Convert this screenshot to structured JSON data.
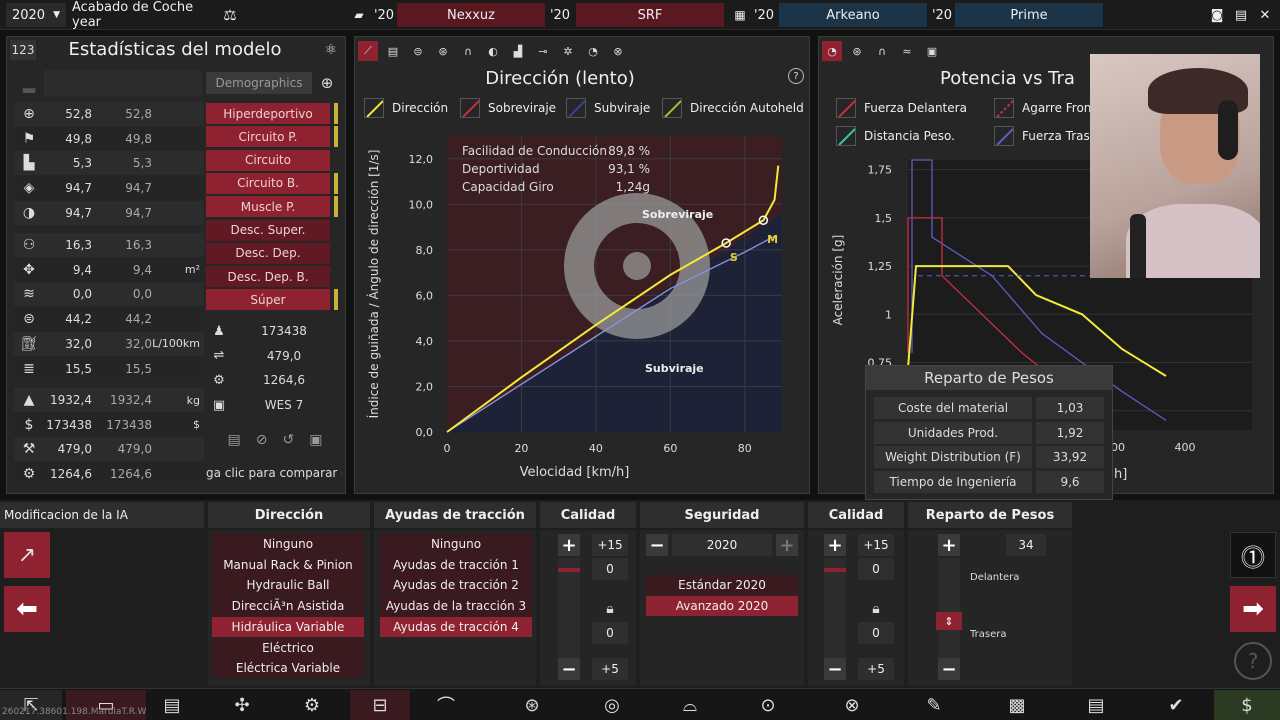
{
  "topbar": {
    "year": "2020",
    "finish": "Acabado de Coche year",
    "competitors": [
      {
        "year": "'20",
        "name": "Nexxuz"
      },
      {
        "year": "'20",
        "name": "SRF"
      },
      {
        "year": "'20",
        "name": "Arkeano"
      },
      {
        "year": "'20",
        "name": "Prime"
      }
    ]
  },
  "left_panel": {
    "badge": "123",
    "title": "Estadísticas del modelo",
    "demographics_label": "Demographics",
    "stats_a": [
      {
        "icon": "steering-icon",
        "v1": "52,8",
        "v2": "52,8",
        "unit": ""
      },
      {
        "icon": "checkered-flag-icon",
        "v1": "49,8",
        "v2": "49,8",
        "unit": ""
      },
      {
        "icon": "seat-icon",
        "v1": "5,3",
        "v2": "5,3",
        "unit": ""
      },
      {
        "icon": "gem-icon",
        "v1": "94,7",
        "v2": "94,7",
        "unit": ""
      },
      {
        "icon": "shield-icon",
        "v1": "94,7",
        "v2": "94,7",
        "unit": ""
      }
    ],
    "stats_b": [
      {
        "icon": "passengers-icon",
        "v1": "16,3",
        "v2": "16,3",
        "unit": ""
      },
      {
        "icon": "dimensions-icon",
        "v1": "9,4",
        "v2": "9,4",
        "unit": "m²"
      },
      {
        "icon": "offroad-icon",
        "v1": "0,0",
        "v2": "0,0",
        "unit": ""
      },
      {
        "icon": "cargo-icon",
        "v1": "44,2",
        "v2": "44,2",
        "unit": ""
      },
      {
        "icon": "fuel-icon",
        "v1": "32,0",
        "v2": "32,0",
        "unit": "L/100km"
      },
      {
        "icon": "emissions-icon",
        "v1": "15,5",
        "v2": "15,5",
        "unit": ""
      }
    ],
    "stats_c": [
      {
        "icon": "weight-icon",
        "v1": "1932,4",
        "v2": "1932,4",
        "unit": "kg"
      },
      {
        "icon": "price-icon",
        "v1": "173438",
        "v2": "173438",
        "unit": "$"
      },
      {
        "icon": "tooling-icon",
        "v1": "479,0",
        "v2": "479,0",
        "unit": ""
      },
      {
        "icon": "gear-icon",
        "v1": "1264,6",
        "v2": "1264,6",
        "unit": ""
      }
    ],
    "demographics": [
      {
        "label": "Hiperdeportivo",
        "dark": false,
        "marker": true
      },
      {
        "label": "Circuito P.",
        "dark": false,
        "marker": true
      },
      {
        "label": "Circuito",
        "dark": false,
        "marker": false
      },
      {
        "label": "Circuito B.",
        "dark": false,
        "marker": true
      },
      {
        "label": "Muscle P.",
        "dark": false,
        "marker": true
      },
      {
        "label": "Desc. Super.",
        "dark": true,
        "marker": false
      },
      {
        "label": "Desc. Dep.",
        "dark": true,
        "marker": false
      },
      {
        "label": "Desc. Dep. B.",
        "dark": true,
        "marker": false
      },
      {
        "label": "Súper",
        "dark": false,
        "marker": true
      }
    ],
    "values": [
      "173438",
      "479,0",
      "1264,6",
      "WES 7"
    ],
    "compare_hint": "ga clic para comparar coc"
  },
  "center_panel": {
    "title": "Dirección (lento)",
    "legend": [
      "Dirección",
      "Sobreviraje",
      "Subviraje",
      "Dirección Autoheld"
    ],
    "info": [
      {
        "k": "Facilidad de Conducción",
        "v": "89,8 %"
      },
      {
        "k": "Deportividad",
        "v": "93,1 %"
      },
      {
        "k": "Capacidad Giro",
        "v": "1,24g"
      }
    ],
    "region_over": "Sobreviraje",
    "region_under": "Subviraje",
    "marker_s": "S",
    "marker_m": "M"
  },
  "chart_data": [
    {
      "type": "line",
      "title": "Dirección (lento)",
      "xlabel": "Velocidad [km/h]",
      "ylabel": "Índice de guiñada / Ángulo de dirección [1/s]",
      "xlim": [
        0,
        90
      ],
      "ylim": [
        0,
        13
      ],
      "xticks": [
        "0",
        "20",
        "40",
        "60",
        "80"
      ],
      "yticks": [
        "0,0",
        "2,0",
        "4,0",
        "6,0",
        "8,0",
        "10,0",
        "12,0"
      ],
      "series": [
        {
          "name": "Dirección",
          "color": "#f2ea3a",
          "x": [
            0,
            20,
            40,
            60,
            75,
            85,
            88,
            89
          ],
          "y": [
            0,
            2.4,
            4.7,
            6.9,
            8.3,
            9.3,
            10.2,
            11.7
          ]
        },
        {
          "name": "Subviraje",
          "color": "#8c8fd8",
          "x": [
            0,
            20,
            40,
            60,
            80,
            88
          ],
          "y": [
            0,
            2.1,
            4.2,
            6.3,
            7.9,
            8.6
          ]
        }
      ]
    },
    {
      "type": "line",
      "title": "Potencia vs Tra",
      "ylabel": "Aceleración [g]",
      "yticks": [
        "0,5",
        "0,75",
        "1",
        "1,25",
        "1,5",
        "1,75"
      ],
      "xticks": [
        "00",
        "400"
      ]
    }
  ],
  "right_panel": {
    "title": "Potencia vs Tra",
    "legend": [
      "Fuerza Delantera",
      "Agarre Front",
      "Distancia Peso.",
      "Fuerza Trase"
    ],
    "weight_title": "Reparto de Pesos",
    "weight_rows": [
      {
        "k": "Coste del material",
        "v": "1,03"
      },
      {
        "k": "Unidades Prod.",
        "v": "1,92"
      },
      {
        "k": "Weight Distribution (F)",
        "v": "33,92"
      },
      {
        "k": "Tiempo de Ingeniería",
        "v": "9,6"
      }
    ],
    "x_unit": "h]"
  },
  "bottom": {
    "ai_label": "Modificacion de la IA",
    "headers": [
      "Dirección",
      "Ayudas de tracción",
      "Calidad",
      "Seguridad",
      "Calidad",
      "Reparto de Pesos"
    ],
    "steering": [
      "Ninguno",
      "Manual Rack & Pinion",
      "Hydraulic Ball",
      "DirecciÃ³n Asistida",
      "Hidráulica Variable",
      "Eléctrico",
      "Eléctrica Variable"
    ],
    "steering_selected": 4,
    "traction": [
      "Ninguno",
      "Ayudas de tracción 1",
      "Ayudas de tracción 2",
      "Ayudas de la tracción 3",
      "Ayudas de tracción 4"
    ],
    "traction_selected": 4,
    "quality1": {
      "top": "+15",
      "v1": "0",
      "v2": "0",
      "bottom": "+5"
    },
    "safety": {
      "year": "2020",
      "options": [
        "Estándar 2020",
        "Avanzado 2020"
      ],
      "selected": 1
    },
    "quality2": {
      "top": "+15",
      "v1": "0",
      "v2": "0",
      "bottom": "+5"
    },
    "weight": {
      "value": "34",
      "front": "Delantera",
      "rear": "Trasera"
    },
    "version": "260217.38601.198.MarulaT.R.W"
  }
}
